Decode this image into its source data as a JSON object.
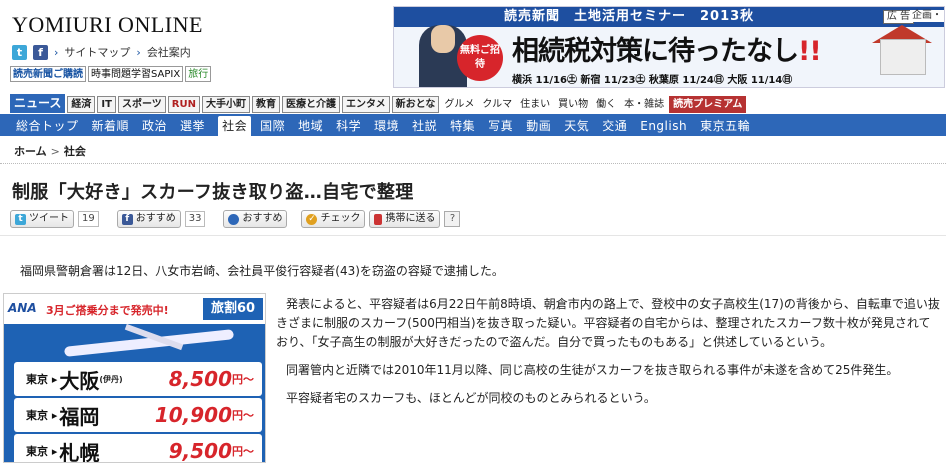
{
  "site": {
    "logo": "YOMIURI ONLINE",
    "links": [
      "サイトマップ",
      "会社案内"
    ],
    "tags": [
      "読売新聞ご購読",
      "時事問題学習SAPIX",
      "旅行"
    ]
  },
  "top_ad": {
    "header": "読売新聞　土地活用セミナー　2013秋",
    "ad_label": "広 告",
    "corp_label": "企画・",
    "badge": "無料ご招待",
    "catch": "相続税対策に待ったなし",
    "catch_mark": "!!",
    "dates": "横浜 11/16㊏ 新宿 11/23㊏ 秋葉原 11/24㊐ 大阪 11/14㊐"
  },
  "categories_primary": [
    {
      "label": "ニュース",
      "style": "news"
    },
    {
      "label": "経済",
      "style": "c1"
    },
    {
      "label": "IT",
      "style": "c1"
    },
    {
      "label": "スポーツ",
      "style": "c1"
    },
    {
      "label": "RUN",
      "style": "run"
    },
    {
      "label": "大手小町",
      "style": "c1"
    },
    {
      "label": "教育",
      "style": "c1"
    },
    {
      "label": "医療と介護",
      "style": "c1"
    },
    {
      "label": "エンタメ",
      "style": "c1"
    },
    {
      "label": "新おとな",
      "style": "c1"
    },
    {
      "label": "グルメ",
      "style": "plain"
    },
    {
      "label": "クルマ",
      "style": "plain"
    },
    {
      "label": "住まい",
      "style": "plain"
    },
    {
      "label": "買い物",
      "style": "plain"
    },
    {
      "label": "働く",
      "style": "plain"
    },
    {
      "label": "本・雑誌",
      "style": "plain"
    },
    {
      "label": "読売プレミアム",
      "style": "prem"
    }
  ],
  "categories_secondary": [
    "総合トップ",
    "新着順",
    "政治",
    "選挙",
    "社会",
    "国際",
    "地域",
    "科学",
    "環境",
    "社説",
    "特集",
    "写真",
    "動画",
    "天気",
    "交通",
    "English",
    "東京五輪"
  ],
  "active_secondary": "社会",
  "breadcrumb": {
    "home": "ホーム",
    "sep": ">",
    "current": "社会"
  },
  "article": {
    "title": "制服「大好き」スカーフ抜き取り盗…自宅で整理",
    "lead": "福岡県警朝倉署は12日、八女市岩崎、会社員平俊行容疑者(43)を窃盗の容疑で逮捕した。",
    "paragraphs": [
      "発表によると、平容疑者は6月22日午前8時頃、朝倉市内の路上で、登校中の女子高校生(17)の背後から、自転車で追い抜きざまに制服のスカーフ(500円相当)を抜き取った疑い。平容疑者の自宅からは、整理されたスカーフ数十枚が発見されており、「女子高生の制服が大好きだったので盗んだ。自分で買ったものもある」と供述しているという。",
      "同署管内と近隣では2010年11月以降、同じ高校の生徒がスカーフを抜き取られる事件が未遂を含めて25件発生。",
      "平容疑者宅のスカーフも、ほとんどが同校のものとみられるという。"
    ]
  },
  "share": {
    "tweet_label": "ツイート",
    "tweet_count": "19",
    "fb_label": "おすすめ",
    "fb_count": "33",
    "mixi_label": "おすすめ",
    "check_label": "チェック",
    "mobile_label": "携帯に送る",
    "help_label": "?"
  },
  "side_ad": {
    "brand": "ANA",
    "headline": "3月ご搭乗分まで発売中!",
    "product": "旅割60",
    "fares": [
      {
        "from": "東京",
        "to": "大阪",
        "sub": "(伊丹)",
        "price": "8,500",
        "yen": "円〜"
      },
      {
        "from": "東京",
        "to": "福岡",
        "sub": "",
        "price": "10,900",
        "yen": "円〜"
      },
      {
        "from": "東京",
        "to": "札幌",
        "sub": "",
        "price": "9,500",
        "yen": "円〜"
      }
    ]
  }
}
